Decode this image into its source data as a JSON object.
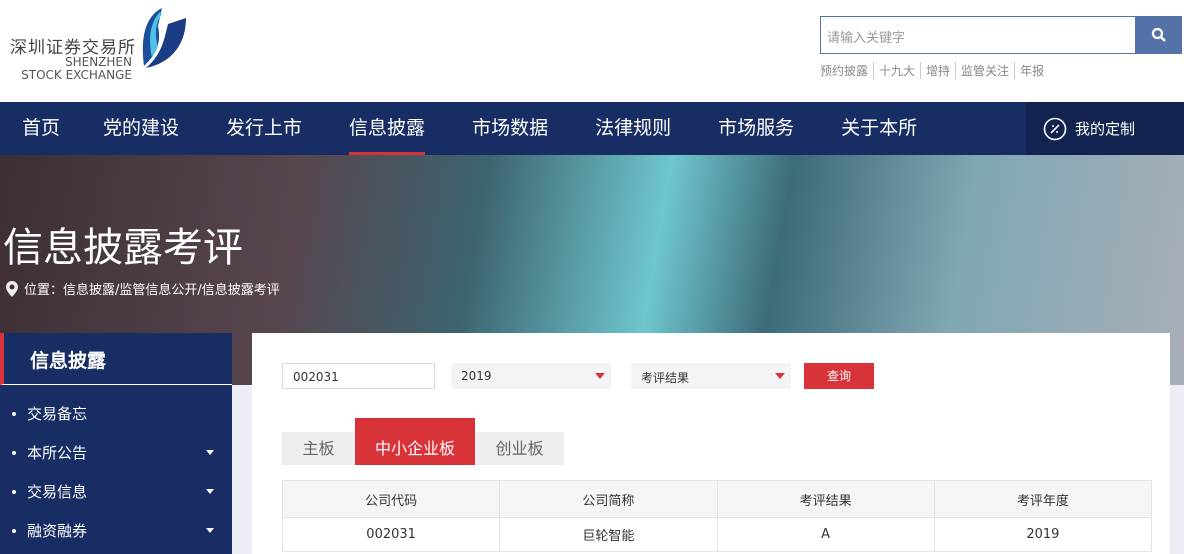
{
  "header": {
    "logo": {
      "name_cn": "深圳证券交易所",
      "name_en_1": "SHENZHEN",
      "name_en_2": "STOCK EXCHANGE"
    },
    "search": {
      "placeholder": "请输入关键字",
      "icon": "search-icon"
    },
    "hot_links": [
      "预约披露",
      "十九大",
      "增持",
      "监管关注",
      "年报"
    ]
  },
  "nav": {
    "items": [
      "首页",
      "党的建设",
      "发行上市",
      "信息披露",
      "市场数据",
      "法律规则",
      "市场服务",
      "关于本所"
    ],
    "active": "信息披露",
    "mine": "我的定制"
  },
  "banner": {
    "title": "信息披露考评",
    "breadcrumb": "位置：信息披露/监管信息公开/信息披露考评"
  },
  "sidebar": {
    "title": "信息披露",
    "items": [
      {
        "label": "交易备忘",
        "expandable": false
      },
      {
        "label": "本所公告",
        "expandable": true
      },
      {
        "label": "交易信息",
        "expandable": true
      },
      {
        "label": "融资融券",
        "expandable": true
      }
    ]
  },
  "filters": {
    "code": "002031",
    "year": "2019",
    "result": "考评结果",
    "query": "查询"
  },
  "tabs": [
    "主板",
    "中小企业板",
    "创业板"
  ],
  "table": {
    "headers": [
      "公司代码",
      "公司简称",
      "考评结果",
      "考评年度"
    ],
    "rows": [
      [
        "002031",
        "巨轮智能",
        "A",
        "2019"
      ]
    ]
  },
  "colors": {
    "nav": "#172d63",
    "accent": "#d9333a",
    "search": "#5572a8"
  }
}
